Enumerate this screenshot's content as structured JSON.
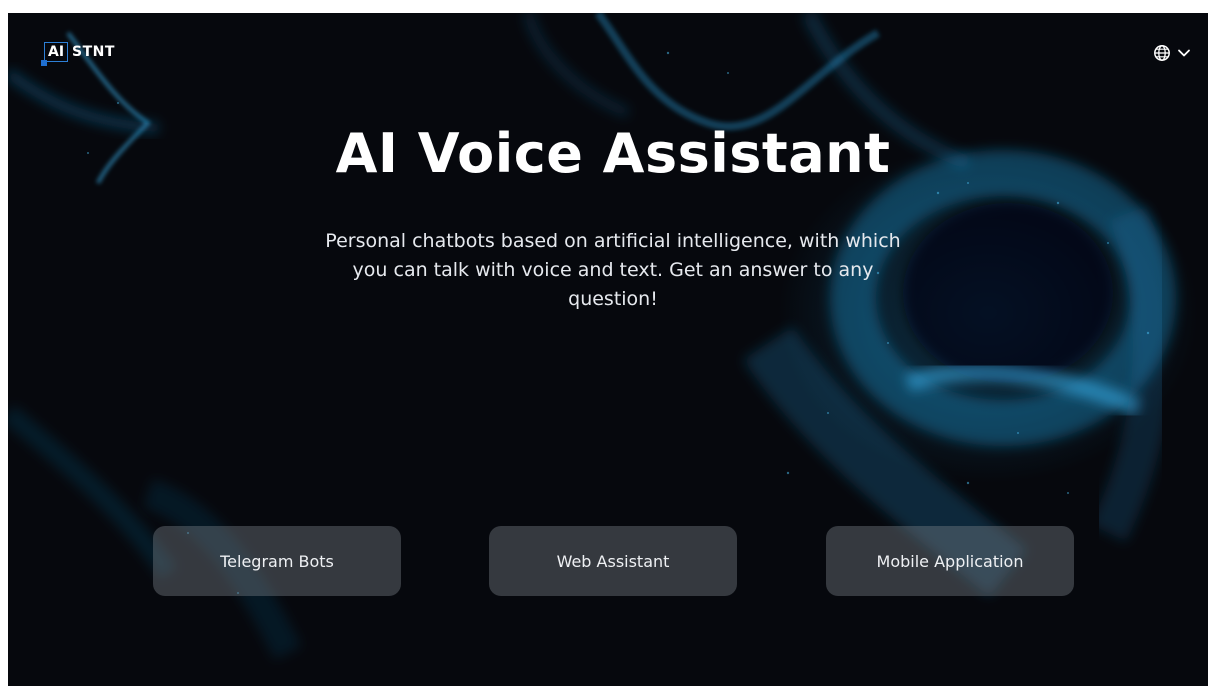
{
  "header": {
    "logo_mark": "AI",
    "logo_text": "STNT",
    "language_icon": "globe-icon",
    "dropdown_icon": "chevron-down-icon"
  },
  "hero": {
    "title": "AI Voice Assistant",
    "subtitle": "Personal chatbots based on artificial intelligence, with which you can talk with voice and text. Get an answer to any question!"
  },
  "buttons": [
    {
      "label": "Telegram Bots"
    },
    {
      "label": "Web Assistant"
    },
    {
      "label": "Mobile Application"
    }
  ],
  "colors": {
    "background": "#06080d",
    "accent": "#1f9fe0",
    "logo_border": "#2d7fd6",
    "button_bg": "#5c6168"
  }
}
